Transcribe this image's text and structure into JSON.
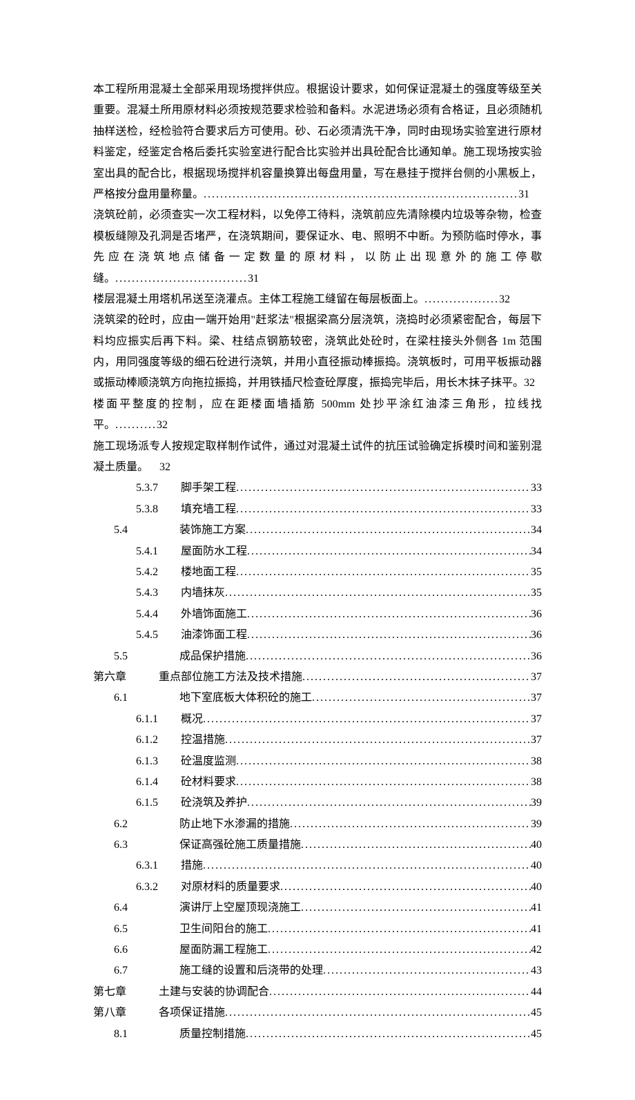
{
  "paragraphs": [
    {
      "text": "本工程所用混凝土全部采用现场搅拌供应。根据设计要求，如何保证混凝土的强度等级至关重要。混凝土所用原材料必须按规范要求检验和备料。水泥进场必须有合格证，且必须随机抽样送检，经检验符合要求后方可使用。砂、石必须清洗干净，同时由现场实验室进行原材料鉴定，经鉴定合格后委托实验室进行配合比实验并出具砼配合比通知单。施工现场按实验室出具的配合比，根据现场搅拌机容量换算出每盘用量，写在悬挂于搅拌台侧的小黑板上，严格按分盘用量称量。",
      "page": "31"
    },
    {
      "text": "浇筑砼前，必须查实一次工程材料，以免停工待料，浇筑前应先清除模内垃圾等杂物，检查模板缝隙及孔洞是否堵严，在浇筑期间，要保证水、电、照明不中断。为预防临时停水，事先应在浇筑地点储备一定数量的原材料，以防止出现意外的施工停歇缝。",
      "page": "31"
    },
    {
      "text": "楼层混凝土用塔机吊送至浇灌点。主体工程施工缝留在每层板面上。",
      "page": "32"
    },
    {
      "text": "浇筑梁的砼时，应由一端开始用\"赶浆法\"根据梁高分层浇筑，浇捣时必须紧密配合，每层下料均应振实后再下料。梁、柱结点钢筋较密，浇筑此处砼时，在梁柱接头外侧各 1m 范围内，用同强度等级的细石砼进行浇筑，并用小直径振动棒振捣。浇筑板时，可用平板振动器或振动棒顺浇筑方向拖拉振捣，并用铁插尺检查砼厚度，振捣完毕后，用长木抹子抹平。",
      "page": "32",
      "nodots": true
    },
    {
      "text": "楼面平整度的控制，应在距楼面墙插筋 500mm 处抄平涂红油漆三角形，拉线找平。",
      "page": "32"
    },
    {
      "text": "施工现场派专人按规定取样制作试件，通过对混凝土试件的抗压试验确定拆模时间和鉴别混凝土质量。",
      "page": "32",
      "plain": true
    }
  ],
  "toc": [
    {
      "indent": 1,
      "label": "5.3.7",
      "title": "脚手架工程",
      "page": "33",
      "labelClass": "label-narrow"
    },
    {
      "indent": 1,
      "label": "5.3.8",
      "title": "填充墙工程",
      "page": "33",
      "labelClass": "label-narrow"
    },
    {
      "indent": 0.5,
      "label": "5.4",
      "title": "装饰施工方案",
      "page": "34",
      "labelClass": "label-wide"
    },
    {
      "indent": 1,
      "label": "5.4.1",
      "title": "屋面防水工程",
      "page": "34",
      "labelClass": "label-narrow"
    },
    {
      "indent": 1,
      "label": "5.4.2",
      "title": "楼地面工程",
      "page": "35",
      "labelClass": "label-narrow"
    },
    {
      "indent": 1,
      "label": "5.4.3",
      "title": "内墙抹灰",
      "page": "35",
      "labelClass": "label-narrow"
    },
    {
      "indent": 1,
      "label": "5.4.4",
      "title": "外墙饰面施工",
      "page": "36",
      "labelClass": "label-narrow"
    },
    {
      "indent": 1,
      "label": "5.4.5",
      "title": "油漆饰面工程",
      "page": "36",
      "labelClass": "label-narrow"
    },
    {
      "indent": 0.5,
      "label": "5.5",
      "title": "成品保护措施",
      "page": "36",
      "labelClass": "label-wide"
    },
    {
      "indent": 0,
      "label": "第六章",
      "title": "重点部位施工方法及技术措施",
      "page": "37",
      "labelClass": "label-chapter"
    },
    {
      "indent": 0.5,
      "label": "6.1",
      "title": "地下室底板大体积砼的施工",
      "page": "37",
      "labelClass": "label-wide"
    },
    {
      "indent": 1,
      "label": "6.1.1",
      "title": "概况",
      "page": "37",
      "labelClass": "label-narrow"
    },
    {
      "indent": 1,
      "label": "6.1.2",
      "title": "控温措施",
      "page": "37",
      "labelClass": "label-narrow"
    },
    {
      "indent": 1,
      "label": "6.1.3",
      "title": "砼温度监测",
      "page": "38",
      "labelClass": "label-narrow"
    },
    {
      "indent": 1,
      "label": "6.1.4",
      "title": "砼材料要求",
      "page": "38",
      "labelClass": "label-narrow"
    },
    {
      "indent": 1,
      "label": "6.1.5",
      "title": "砼浇筑及养护",
      "page": "39",
      "labelClass": "label-narrow"
    },
    {
      "indent": 0.5,
      "label": "6.2",
      "title": "防止地下水渗漏的措施",
      "page": "39",
      "labelClass": "label-wide"
    },
    {
      "indent": 0.5,
      "label": "6.3",
      "title": "保证高强砼施工质量措施",
      "page": "40",
      "labelClass": "label-wide"
    },
    {
      "indent": 1,
      "label": "6.3.1",
      "title": "措施",
      "page": "40",
      "labelClass": "label-narrow"
    },
    {
      "indent": 1,
      "label": "6.3.2",
      "title": "对原材料的质量要求",
      "page": "40",
      "labelClass": "label-narrow"
    },
    {
      "indent": 0.5,
      "label": "6.4",
      "title": "演讲厅上空屋顶现浇施工",
      "page": "41",
      "labelClass": "label-wide"
    },
    {
      "indent": 0.5,
      "label": "6.5",
      "title": "卫生间阳台的施工",
      "page": "41",
      "labelClass": "label-wide"
    },
    {
      "indent": 0.5,
      "label": "6.6",
      "title": "屋面防漏工程施工",
      "page": "42",
      "labelClass": "label-wide"
    },
    {
      "indent": 0.5,
      "label": "6.7",
      "title": "施工缝的设置和后浇带的处理",
      "page": "43",
      "labelClass": "label-wide"
    },
    {
      "indent": 0,
      "label": "第七章",
      "title": "土建与安装的协调配合",
      "page": "44",
      "labelClass": "label-chapter"
    },
    {
      "indent": 0,
      "label": "第八章",
      "title": "各项保证措施",
      "page": "45",
      "labelClass": "label-chapter"
    },
    {
      "indent": 0.5,
      "label": "8.1",
      "title": "质量控制措施",
      "page": "45",
      "labelClass": "label-wide"
    }
  ]
}
